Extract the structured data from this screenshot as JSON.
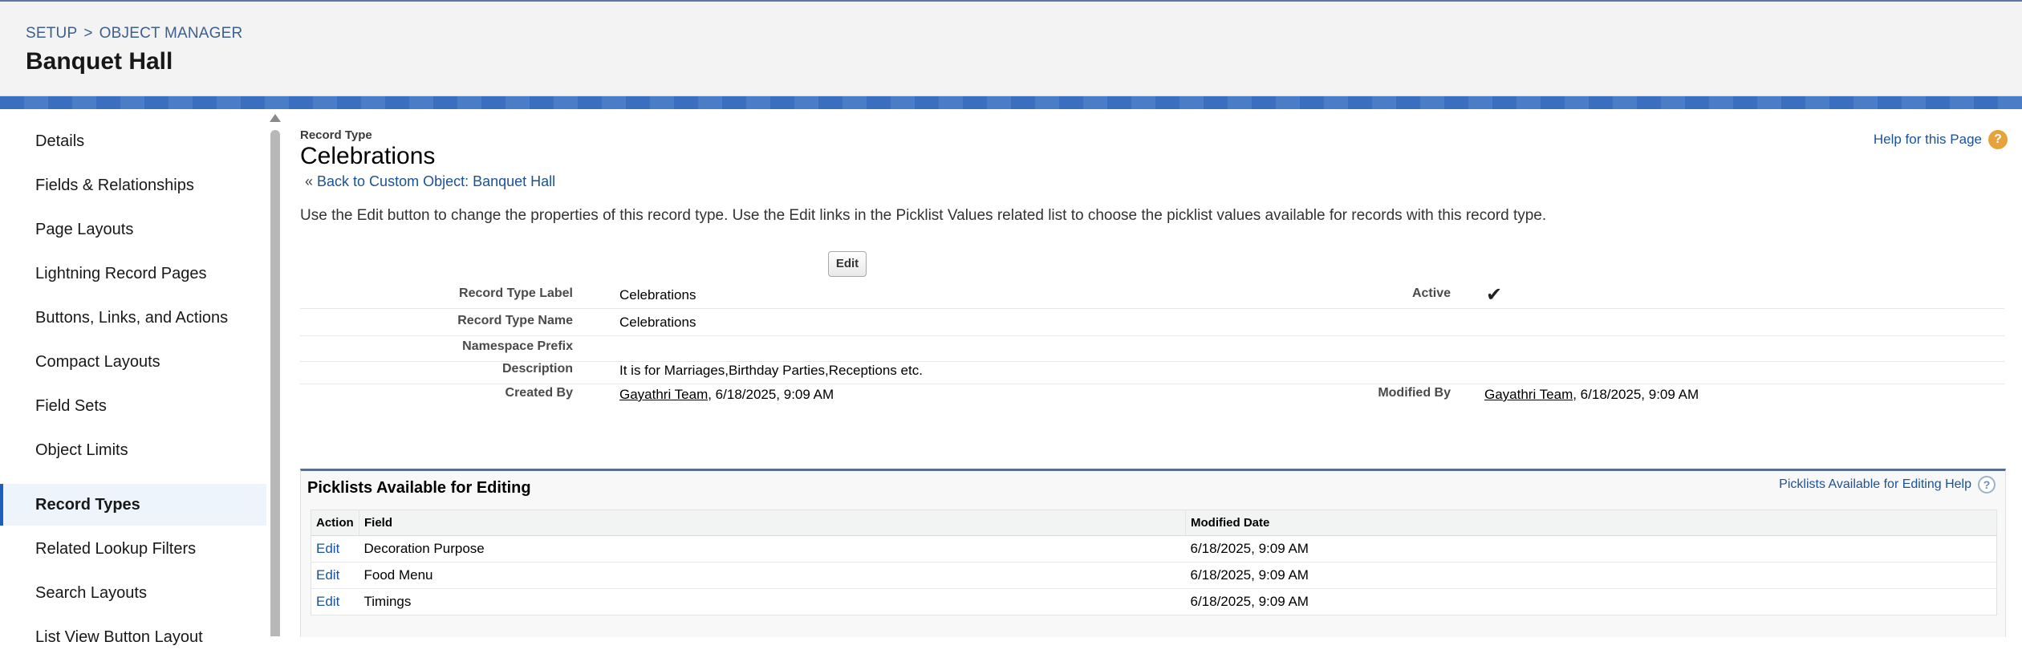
{
  "header": {
    "breadcrumb": {
      "setup": "SETUP",
      "separator": ">",
      "object_manager": "OBJECT MANAGER"
    },
    "title": "Banquet Hall"
  },
  "sidebar": {
    "items": [
      {
        "label": "Details"
      },
      {
        "label": "Fields & Relationships"
      },
      {
        "label": "Page Layouts"
      },
      {
        "label": "Lightning Record Pages"
      },
      {
        "label": "Buttons, Links, and Actions"
      },
      {
        "label": "Compact Layouts"
      },
      {
        "label": "Field Sets"
      },
      {
        "label": "Object Limits"
      },
      {
        "label": "Record Types",
        "active": true
      },
      {
        "label": "Related Lookup Filters"
      },
      {
        "label": "Search Layouts"
      },
      {
        "label": "List View Button Layout"
      }
    ]
  },
  "main": {
    "record_type_caption": "Record Type",
    "record_type_title": "Celebrations",
    "back_prefix": "«",
    "back_link": "Back to Custom Object: Banquet Hall",
    "help_link": "Help for this Page",
    "help_icon": "?",
    "intro_text": "Use the Edit button to change the properties of this record type. Use the Edit links in the Picklist Values related list to choose the picklist values available for records with this record type.",
    "edit_button": "Edit",
    "details": {
      "record_type_label": {
        "label": "Record Type Label",
        "value": "Celebrations"
      },
      "active": {
        "label": "Active",
        "checked": true,
        "check_glyph": "✔"
      },
      "record_type_name": {
        "label": "Record Type Name",
        "value": "Celebrations"
      },
      "namespace_prefix": {
        "label": "Namespace Prefix",
        "value": ""
      },
      "description": {
        "label": "Description",
        "value": "It is for Marriages,Birthday Parties,Receptions etc."
      },
      "created_by": {
        "label": "Created By",
        "user": "Gayathri Team",
        "date": ", 6/18/2025, 9:09 AM"
      },
      "modified_by": {
        "label": "Modified By",
        "user": "Gayathri Team",
        "date": ", 6/18/2025, 9:09 AM"
      }
    }
  },
  "picklists": {
    "title": "Picklists Available for Editing",
    "help_link": "Picklists Available for Editing Help",
    "help_icon": "?",
    "columns": {
      "action": "Action",
      "field": "Field",
      "modified_date": "Modified Date"
    },
    "rows": [
      {
        "action": "Edit",
        "field": "Decoration Purpose",
        "modified_date": "6/18/2025, 9:09 AM"
      },
      {
        "action": "Edit",
        "field": "Food Menu",
        "modified_date": "6/18/2025, 9:09 AM"
      },
      {
        "action": "Edit",
        "field": "Timings",
        "modified_date": "6/18/2025, 9:09 AM"
      }
    ]
  }
}
